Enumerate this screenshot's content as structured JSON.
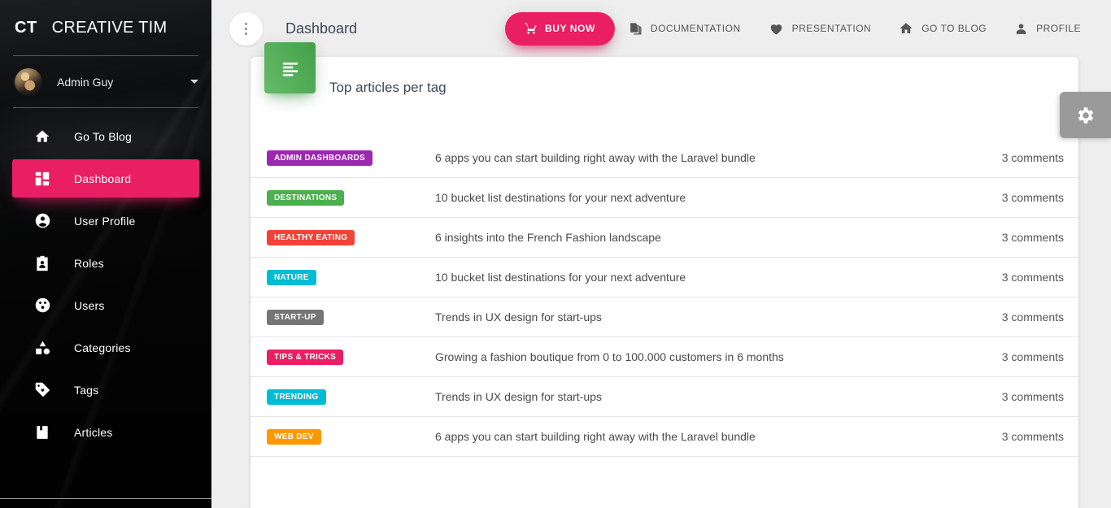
{
  "sidebar": {
    "brand_mark": "CT",
    "brand_text": "CREATIVE TIM",
    "user": {
      "name": "Admin Guy"
    },
    "items": [
      {
        "label": "Go To Blog",
        "icon": "home-icon",
        "active": false
      },
      {
        "label": "Dashboard",
        "icon": "grid-icon",
        "active": true
      },
      {
        "label": "User Profile",
        "icon": "person-icon",
        "active": false
      },
      {
        "label": "Roles",
        "icon": "badge-id-icon",
        "active": false
      },
      {
        "label": "Users",
        "icon": "group-icon",
        "active": false
      },
      {
        "label": "Categories",
        "icon": "shapes-icon",
        "active": false
      },
      {
        "label": "Tags",
        "icon": "tag-icon",
        "active": false
      },
      {
        "label": "Articles",
        "icon": "book-icon",
        "active": false
      }
    ]
  },
  "topbar": {
    "menu_icon": "vertical-dots-icon",
    "page_title": "Dashboard",
    "buy_now_label": "BUY NOW",
    "buy_now_icon": "shopping-cart-icon",
    "links": [
      {
        "label": "DOCUMENTATION",
        "icon": "documents-icon"
      },
      {
        "label": "PRESENTATION",
        "icon": "heart-icon"
      },
      {
        "label": "GO TO BLOG",
        "icon": "home-icon"
      },
      {
        "label": "PROFILE",
        "icon": "person-icon"
      }
    ]
  },
  "card": {
    "badge_icon": "text-lines-icon",
    "badge_color": "#4caf50",
    "title": "Top articles per tag",
    "rows": [
      {
        "tag": "ADMIN DASHBOARDS",
        "tag_color": "#9c27b0",
        "title": "6 apps you can start building right away with the Laravel bundle",
        "comments": "3 comments"
      },
      {
        "tag": "DESTINATIONS",
        "tag_color": "#4caf50",
        "title": "10 bucket list destinations for your next adventure",
        "comments": "3 comments"
      },
      {
        "tag": "HEALTHY EATING",
        "tag_color": "#f44336",
        "title": "6 insights into the French Fashion landscape",
        "comments": "3 comments"
      },
      {
        "tag": "NATURE",
        "tag_color": "#00bcd4",
        "title": "10 bucket list destinations for your next adventure",
        "comments": "3 comments"
      },
      {
        "tag": "START-UP",
        "tag_color": "#757575",
        "title": "Trends in UX design for start-ups",
        "comments": "3 comments"
      },
      {
        "tag": "TIPS & TRICKS",
        "tag_color": "#e91e63",
        "title": "Growing a fashion boutique from 0 to 100.000 customers in 6 months",
        "comments": "3 comments"
      },
      {
        "tag": "TRENDING",
        "tag_color": "#00bcd4",
        "title": "Trends in UX design for start-ups",
        "comments": "3 comments"
      },
      {
        "tag": "WEB DEV",
        "tag_color": "#ff9800",
        "title": "6 apps you can start building right away with the Laravel bundle",
        "comments": "3 comments"
      }
    ]
  },
  "settings": {
    "icon": "gear-icon"
  },
  "colors": {
    "accent_pink": "#e91e63",
    "sidebar_bg": "#0a0a0a",
    "page_bg": "#eeeeee",
    "title_text": "#3c4858"
  }
}
